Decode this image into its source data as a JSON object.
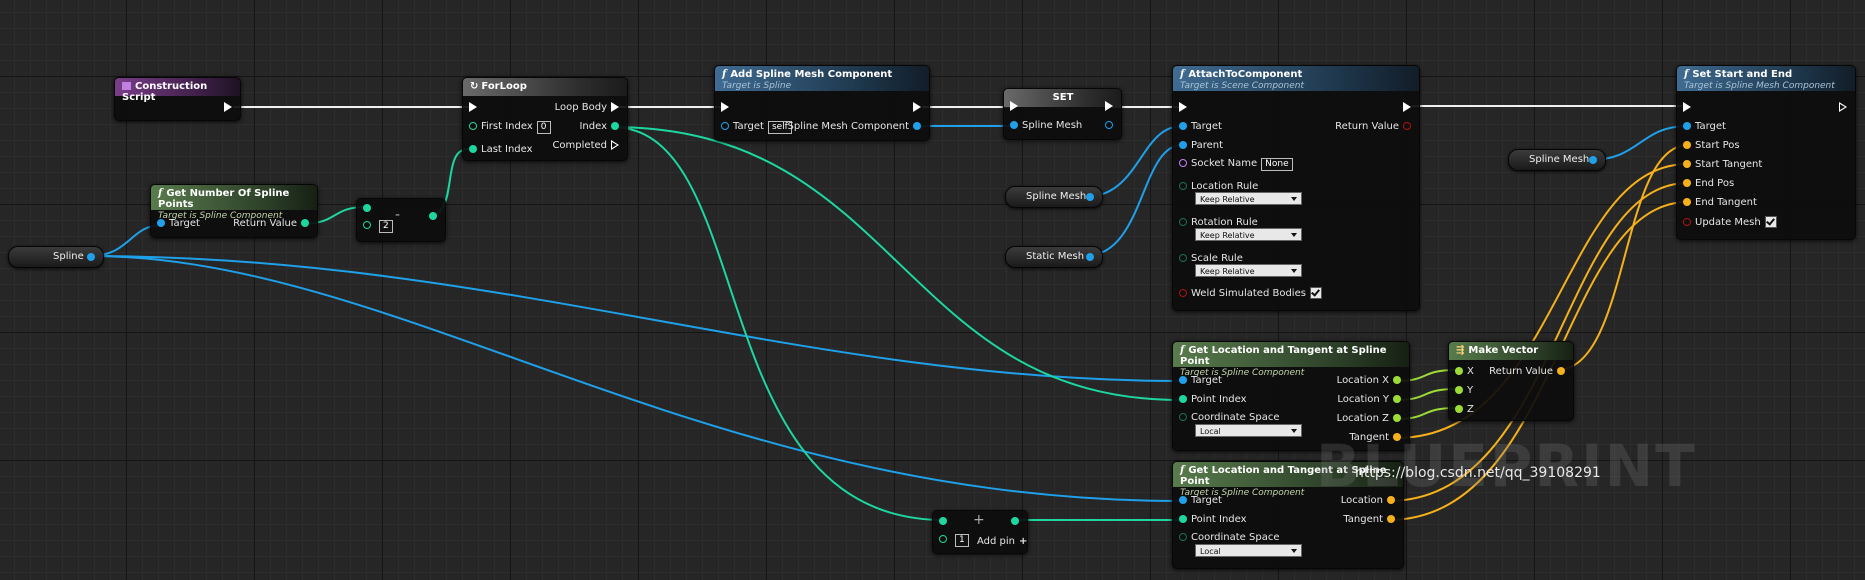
{
  "nodes": {
    "construction_script": {
      "title": "Construction Script"
    },
    "forloop": {
      "title": "ForLoop",
      "first_index_label": "First Index",
      "first_index_value": "0",
      "last_index_label": "Last Index",
      "loop_body_label": "Loop Body",
      "index_label": "Index",
      "completed_label": "Completed"
    },
    "add_spline_mesh": {
      "title": "Add Spline Mesh Component",
      "subtitle": "Target is Spline",
      "target_label": "Target",
      "target_value": "self",
      "output_label": "Spline Mesh Component"
    },
    "set_node": {
      "title": "SET",
      "pin_label": "Spline Mesh"
    },
    "attach": {
      "title": "AttachToComponent",
      "subtitle": "Target is Scene Component",
      "target_label": "Target",
      "parent_label": "Parent",
      "socket_label": "Socket Name",
      "socket_value": "None",
      "return_label": "Return Value",
      "location_rule_label": "Location Rule",
      "location_rule_value": "Keep Relative",
      "rotation_rule_label": "Rotation Rule",
      "rotation_rule_value": "Keep Relative",
      "scale_rule_label": "Scale Rule",
      "scale_rule_value": "Keep Relative",
      "weld_label": "Weld Simulated Bodies"
    },
    "set_start_end": {
      "title": "Set Start and End",
      "subtitle": "Target is Spline Mesh Component",
      "target_label": "Target",
      "start_pos_label": "Start Pos",
      "start_tangent_label": "Start Tangent",
      "end_pos_label": "End Pos",
      "end_tangent_label": "End Tangent",
      "update_mesh_label": "Update Mesh"
    },
    "get_num_points": {
      "title": "Get Number Of Spline Points",
      "subtitle": "Target is Spline Component",
      "target_label": "Target",
      "return_label": "Return Value"
    },
    "subtract": {
      "operator": "-",
      "value": "2"
    },
    "add": {
      "operator": "+",
      "value": "1",
      "add_pin_label": "Add pin"
    },
    "get_loc_tan_1": {
      "title": "Get Location and Tangent at Spline Point",
      "subtitle": "Target is Spline Component",
      "target_label": "Target",
      "point_index_label": "Point Index",
      "coord_label": "Coordinate Space",
      "coord_value": "Local",
      "loc_x_label": "Location X",
      "loc_y_label": "Location Y",
      "loc_z_label": "Location Z",
      "tangent_label": "Tangent"
    },
    "get_loc_tan_2": {
      "title": "Get Location and Tangent at Spline Point",
      "subtitle": "Target is Spline Component",
      "target_label": "Target",
      "point_index_label": "Point Index",
      "coord_label": "Coordinate Space",
      "coord_value": "Local",
      "location_label": "Location",
      "tangent_label": "Tangent"
    },
    "make_vector": {
      "title": "Make Vector",
      "x_label": "X",
      "y_label": "Y",
      "z_label": "Z",
      "return_label": "Return Value"
    }
  },
  "variables": {
    "spline": "Spline",
    "spline_mesh_a": "Spline Mesh",
    "static_mesh": "Static Mesh",
    "spline_mesh_b": "Spline Mesh"
  },
  "watermark": "BLUEPRINT",
  "url": "https://blog.csdn.net/qq_39108291",
  "colors": {
    "object": "#1fa0e8",
    "integer": "#1dd6a0",
    "vector": "#f5b11b",
    "float": "#9ddc36",
    "exec": "#ffffff"
  }
}
